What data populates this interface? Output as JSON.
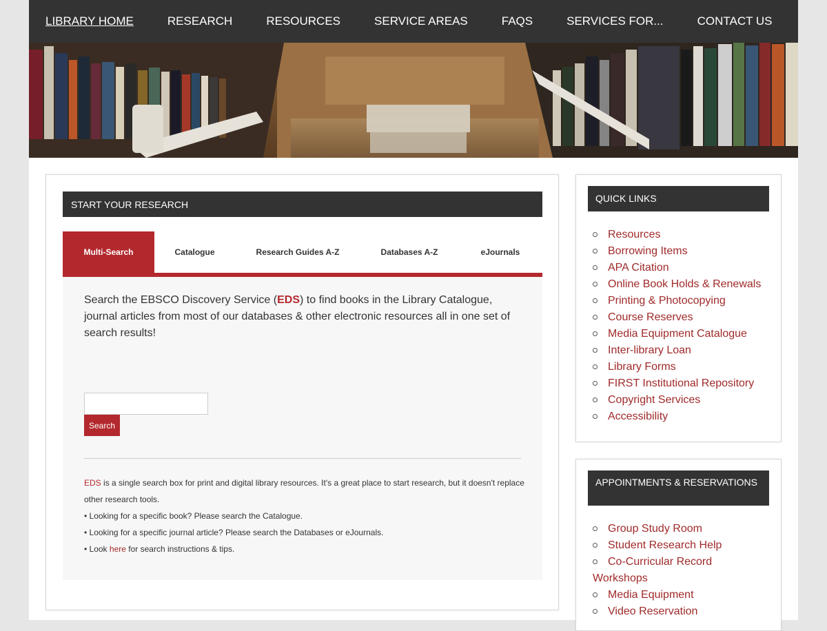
{
  "nav": {
    "items": [
      "LIBRARY HOME",
      "RESEARCH",
      "RESOURCES",
      "SERVICE AREAS",
      "FAQS",
      "SERVICES FOR...",
      "CONTACT US"
    ]
  },
  "research": {
    "heading": "START YOUR RESEARCH",
    "tabs": [
      "Multi-Search",
      "Catalogue",
      "Research Guides A-Z",
      "Databases A-Z",
      "eJournals"
    ],
    "intro_before": "Search the EBSCO Discovery Service (",
    "intro_eds": "EDS",
    "intro_after": ") to find books in the Library Catalogue, journal articles from most of our databases & other electronic resources all in one set of search results!",
    "search_button": "Search",
    "notes": {
      "eds": "EDS",
      "line1": " is a single search box for print and digital library resources. It's a great place to start research, but it doesn't replace other research tools.",
      "line2": "• Looking for a specific book? Please search the Catalogue.",
      "line3": "• Looking for a specific journal article? Please search the Databases or eJournals.",
      "line4_before": "• Look ",
      "line4_link": "here",
      "line4_after": " for search instructions & tips."
    }
  },
  "quick_links": {
    "heading": "QUICK LINKS",
    "items": [
      "Resources",
      "Borrowing Items",
      "APA Citation",
      "Online Book Holds & Renewals",
      "Printing & Photocopying",
      "Course Reserves",
      "Media Equipment Catalogue",
      "Inter-library Loan",
      "Library Forms",
      "FIRST Institutional Repository",
      "Copyright Services",
      "Accessibility"
    ]
  },
  "appointments": {
    "heading": "APPOINTMENTS & RESERVATIONS",
    "items": [
      "Group Study Room",
      "Student Research Help",
      "Co-Curricular Record",
      "Workshops",
      "Media Equipment",
      "Video Reservation"
    ]
  },
  "colors": {
    "accent": "#b3282d",
    "nav_bg": "#333333",
    "link": "#a02a2a"
  }
}
